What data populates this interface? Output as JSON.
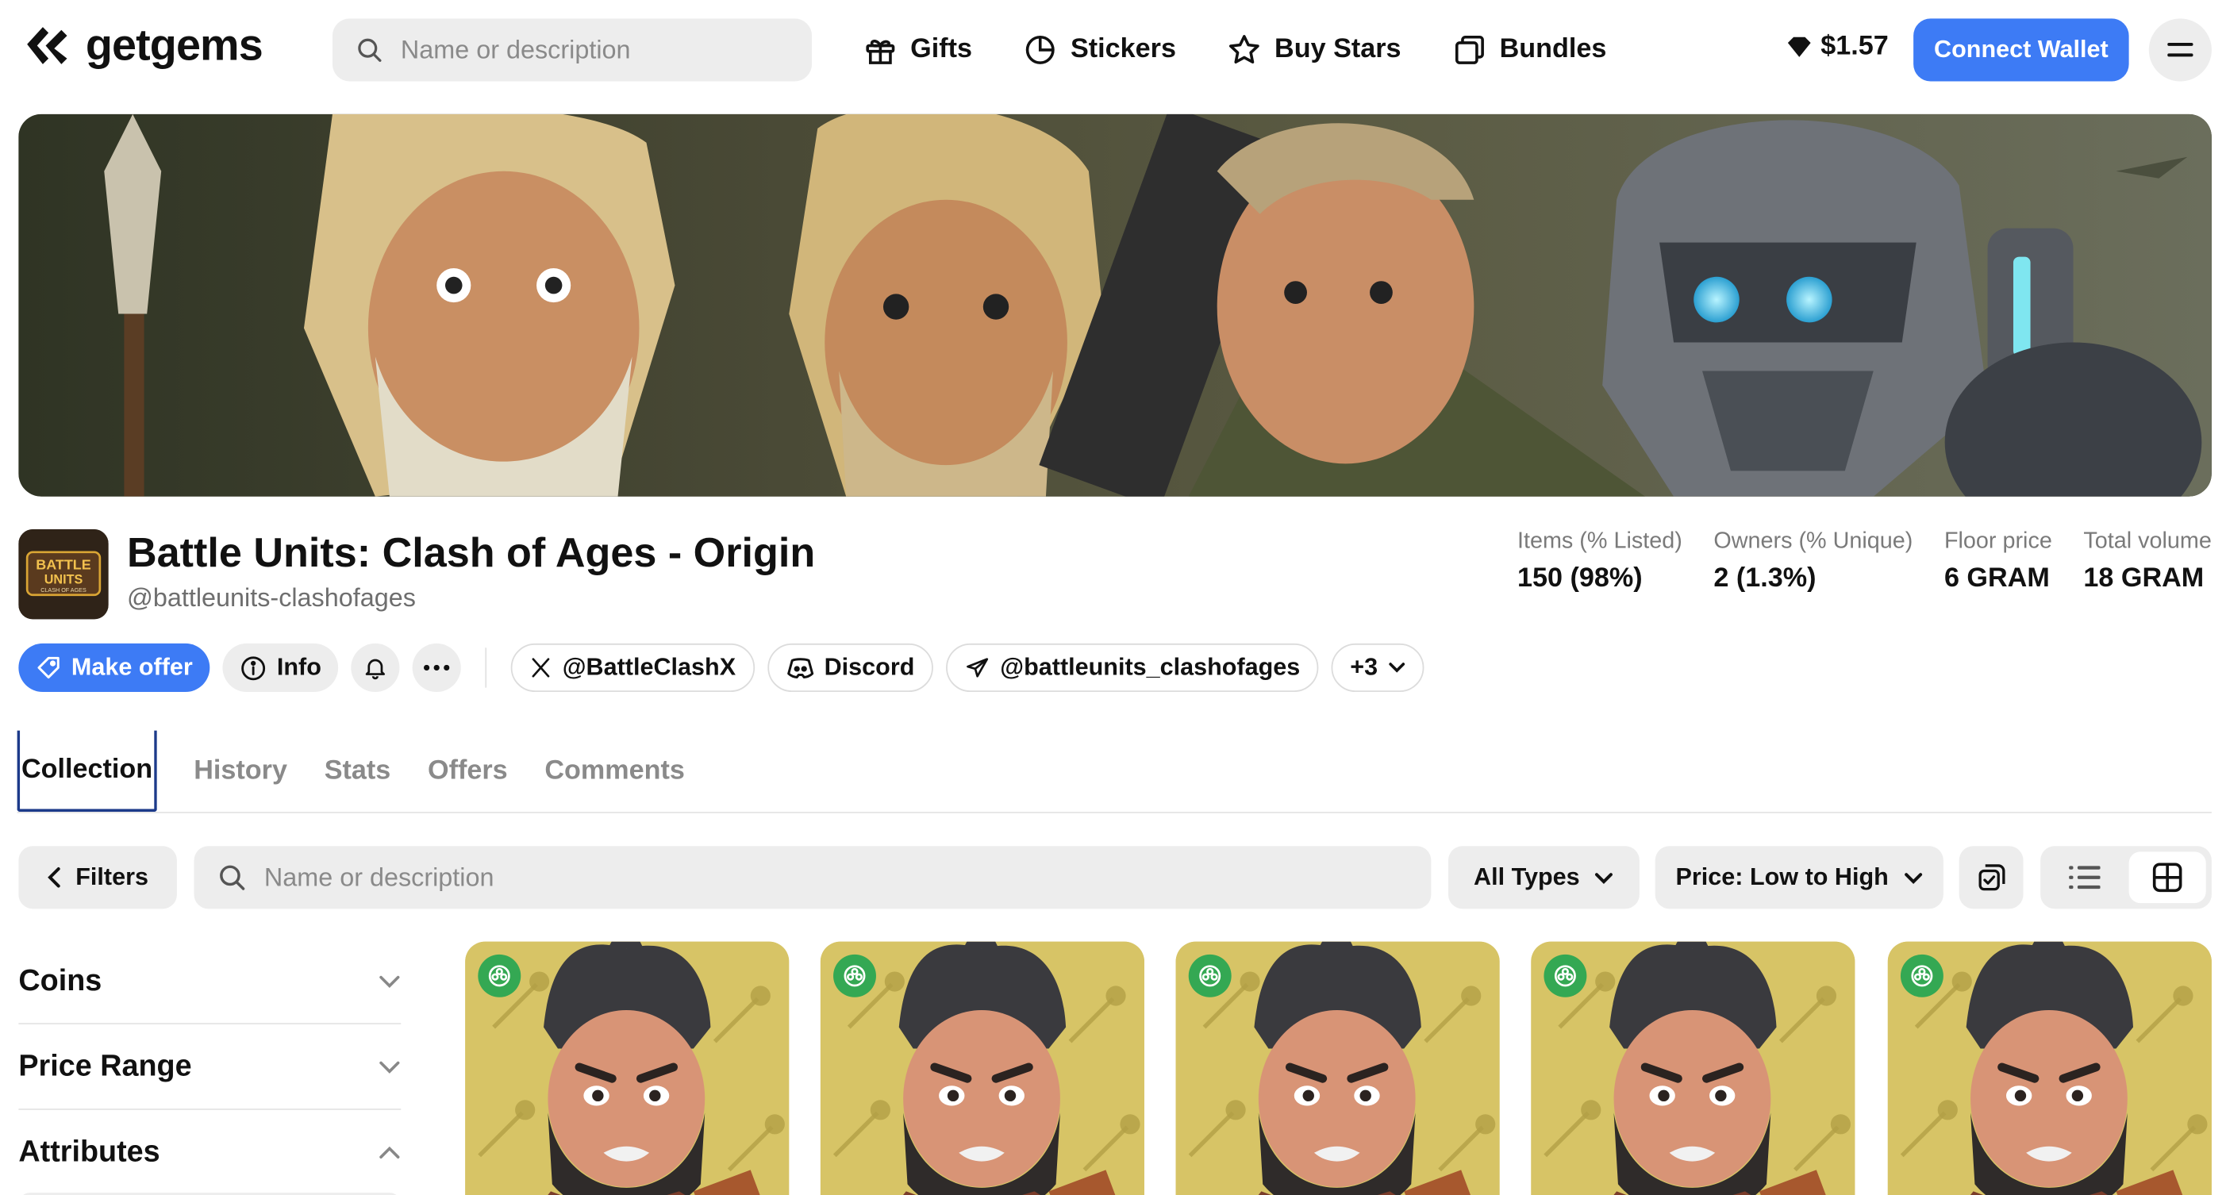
{
  "header": {
    "logo_text": "getgems",
    "search_placeholder": "Name or description",
    "nav": [
      {
        "label": "Gifts",
        "icon": "gift-icon"
      },
      {
        "label": "Stickers",
        "icon": "sticker-icon"
      },
      {
        "label": "Buy Stars",
        "icon": "star-icon"
      },
      {
        "label": "Bundles",
        "icon": "bundles-icon"
      }
    ],
    "balance": "$1.57",
    "connect_label": "Connect Wallet"
  },
  "collection": {
    "title": "Battle Units: Clash of Ages - Origin",
    "handle": "@battleunits-clashofages",
    "avatar_text": [
      "BATTLE",
      "UNITS",
      "CLASH OF AGES"
    ],
    "stats": [
      {
        "label": "Items (% Listed)",
        "value": "150 (98%)"
      },
      {
        "label": "Owners (% Unique)",
        "value": "2 (1.3%)"
      },
      {
        "label": "Floor price",
        "value": "6 GRAM"
      },
      {
        "label": "Total volume",
        "value": "18 GRAM"
      }
    ]
  },
  "actions": {
    "make_offer": "Make offer",
    "info": "Info",
    "twitter": "@BattleClashX",
    "discord": "Discord",
    "telegram": "@battleunits_clashofages",
    "more_links": "+3"
  },
  "tabs": [
    "Collection",
    "History",
    "Stats",
    "Offers",
    "Comments"
  ],
  "toolbar": {
    "filters_label": "Filters",
    "search_placeholder": "Name or description",
    "type_select": "All Types",
    "sort_select": "Price: Low to High"
  },
  "filters": [
    "Coins",
    "Price Range",
    "Attributes"
  ],
  "colors": {
    "accent": "#3d7bf5",
    "badge": "#34a853",
    "card_bg": "#d8c46a"
  }
}
